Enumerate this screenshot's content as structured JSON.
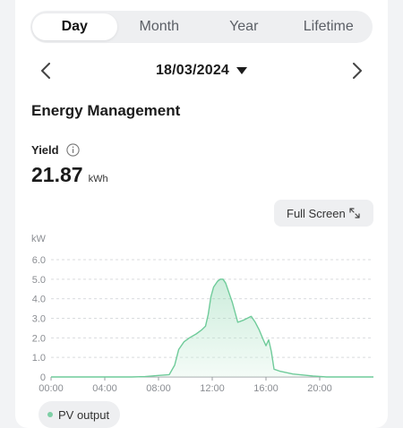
{
  "tabs": [
    {
      "label": "Day",
      "active": true
    },
    {
      "label": "Month",
      "active": false
    },
    {
      "label": "Year",
      "active": false
    },
    {
      "label": "Lifetime",
      "active": false
    }
  ],
  "date_bar": {
    "date": "18/03/2024",
    "prev_icon": "chevron-left-icon",
    "next_icon": "chevron-right-icon",
    "dropdown_icon": "caret-down-icon"
  },
  "section_title": "Energy Management",
  "yield": {
    "label": "Yield",
    "value": "21.87",
    "unit": "kWh",
    "info_icon": "info-icon"
  },
  "fullscreen_button": {
    "label": "Full Screen",
    "icon": "expand-icon"
  },
  "legend": {
    "label": "PV output"
  },
  "colors": {
    "accent_line": "#6fcb9a",
    "area_fill": "#dff5e8",
    "grid": "#d9dbde",
    "axis_text": "#8a8d92"
  },
  "chart_data": {
    "type": "area",
    "title": "",
    "xlabel": "",
    "ylabel": "kW",
    "x_ticks": [
      "00:00",
      "04:00",
      "08:00",
      "12:00",
      "16:00",
      "20:00"
    ],
    "y_ticks": [
      "0",
      "1.0",
      "2.0",
      "3.0",
      "4.0",
      "5.0",
      "6.0"
    ],
    "xlim": [
      0,
      24
    ],
    "ylim": [
      0,
      6
    ],
    "grid": true,
    "series": [
      {
        "name": "PV output",
        "x": [
          0,
          6,
          7,
          8,
          8.8,
          9.2,
          9.5,
          9.9,
          10.3,
          10.8,
          11.2,
          11.5,
          11.7,
          11.9,
          12.1,
          12.4,
          12.6,
          12.8,
          13.0,
          13.3,
          13.5,
          13.7,
          13.9,
          14.1,
          14.3,
          14.6,
          14.9,
          15.2,
          15.5,
          15.8,
          16.0,
          16.2,
          16.4,
          16.6,
          17.0,
          18.0,
          19.5,
          20.5,
          24
        ],
        "y": [
          0,
          0,
          0.02,
          0.08,
          0.12,
          0.6,
          1.4,
          1.8,
          2.0,
          2.2,
          2.4,
          2.6,
          3.2,
          4.1,
          4.6,
          4.9,
          5.0,
          5.0,
          4.8,
          4.2,
          3.8,
          3.3,
          2.8,
          2.85,
          2.9,
          3.0,
          3.1,
          2.8,
          2.4,
          1.9,
          1.6,
          1.9,
          1.3,
          0.4,
          0.3,
          0.15,
          0.05,
          0,
          0
        ]
      }
    ]
  }
}
